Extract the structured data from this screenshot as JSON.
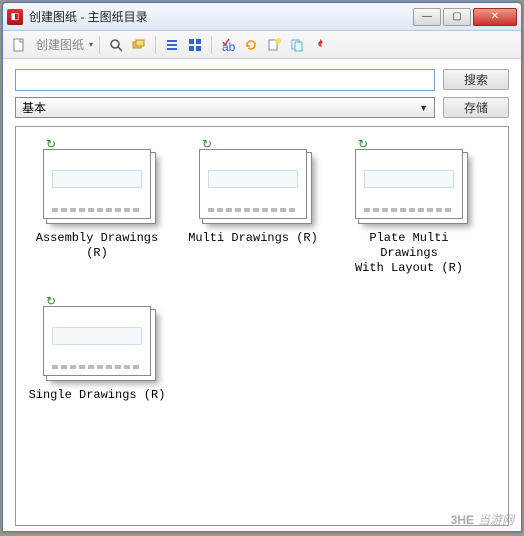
{
  "window": {
    "title": "创建图纸 - 主图纸目录"
  },
  "toolbar": {
    "create_label": "创建图纸"
  },
  "search": {
    "value": "",
    "button": "搜索"
  },
  "category": {
    "selected": "基本",
    "store_button": "存储"
  },
  "items": [
    {
      "label": "Assembly Drawings (R)"
    },
    {
      "label": "Multi Drawings (R)"
    },
    {
      "label": "Plate Multi Drawings\nWith Layout (R)"
    },
    {
      "label": "Single Drawings (R)"
    }
  ],
  "watermark": {
    "brand": "3HE",
    "text": "当游网"
  }
}
